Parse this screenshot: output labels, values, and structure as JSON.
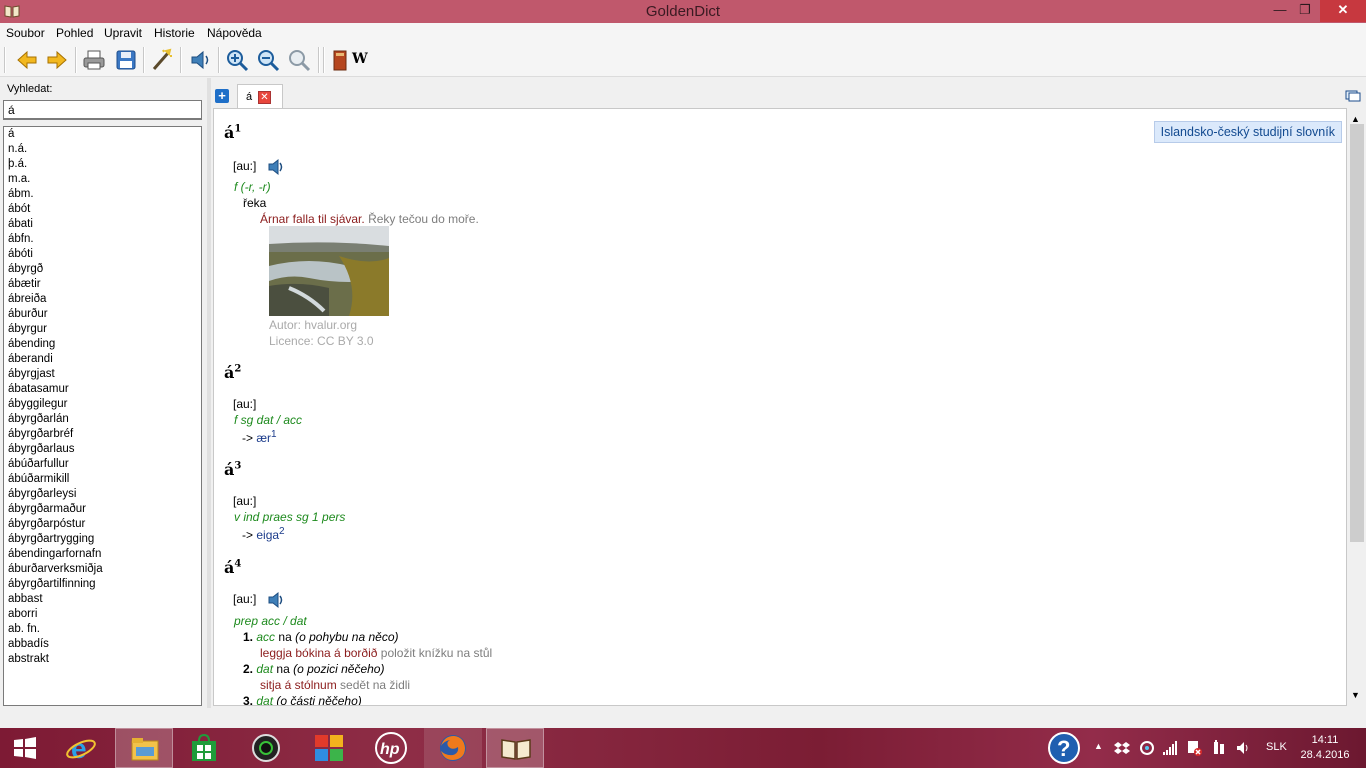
{
  "window": {
    "title": "GoldenDict"
  },
  "menu": [
    "Soubor",
    "Pohled",
    "Upravit",
    "Historie",
    "Nápověda"
  ],
  "toolbar": {
    "icons": [
      "back-icon",
      "forward-icon",
      "print-icon",
      "save-icon",
      "scan-popup-icon",
      "pronounce-icon",
      "zoom-in-icon",
      "zoom-out-icon",
      "zoom-reset-icon",
      "dictionary-book-icon",
      "wikipedia-icon"
    ],
    "wiki_label": "W"
  },
  "search": {
    "label": "Vyhledat:",
    "value": "á"
  },
  "wordlist": [
    "á",
    "n.á.",
    "þ.á.",
    "m.a.",
    "ábm.",
    "ábót",
    "ábati",
    "ábfn.",
    "ábóti",
    "ábyrgð",
    "ábætir",
    "ábreiða",
    "áburður",
    "ábyrgur",
    "ábending",
    "áberandi",
    "ábyrgjast",
    "ábatasamur",
    "ábyggilegur",
    "ábyrgðarlán",
    "ábyrgðarbréf",
    "ábyrgðarlaus",
    "ábúðarfullur",
    "ábúðarmikill",
    "ábyrgðarleysi",
    "ábyrgðarmaður",
    "ábyrgðarpóstur",
    "ábyrgðartrygging",
    "ábendingarfornafn",
    "áburðarverksmiðja",
    "ábyrgðartilfinning",
    "abbast",
    "aborri",
    "ab. fn.",
    "abbadís",
    "abstrakt"
  ],
  "tabs": [
    {
      "label": "á"
    }
  ],
  "article": {
    "dictionary": "Islandsko-český studijní slovník",
    "entries": [
      {
        "headword": "á",
        "sup": "1",
        "pron": "[au:]",
        "gram": "f (-r, -r)",
        "meaning": "řeka",
        "ex_is": "Árnar falla til sjávar.",
        "ex_cs": "Řeky tečou do moře.",
        "image_author": "Autor: hvalur.org",
        "image_license": "Licence: CC BY 3.0"
      },
      {
        "headword": "á",
        "sup": "2",
        "pron": "[au:]",
        "gram": "f sg dat / acc",
        "arrow": "->",
        "ref": "ær",
        "ref_sup": "1"
      },
      {
        "headword": "á",
        "sup": "3",
        "pron": "[au:]",
        "gram": "v ind praes sg 1 pers",
        "arrow": "->",
        "ref": "eiga",
        "ref_sup": "2"
      },
      {
        "headword": "á",
        "sup": "4",
        "pron": "[au:]",
        "gram": "prep acc / dat",
        "senses": [
          {
            "num": "1.",
            "case": "acc",
            "word": "na",
            "note": "(o pohybu na něco)",
            "ex_is": "leggja bókina á borðið",
            "ex_cs": "položit knížku na stůl"
          },
          {
            "num": "2.",
            "case": "dat",
            "word": "na",
            "note": "(o pozici něčeho)",
            "ex_is": "sitja á stólnum",
            "ex_cs": "sedět na židli"
          },
          {
            "num": "3.",
            "case": "dat",
            "word": "",
            "note": "(o části něčeho)"
          }
        ]
      }
    ]
  },
  "taskbar": {
    "apps": [
      "windows-start-icon",
      "internet-explorer-icon",
      "file-explorer-icon",
      "store-icon",
      "camera-app-icon",
      "pinwheel-app-icon",
      "hp-icon",
      "firefox-icon",
      "goldendict-icon"
    ],
    "tray": {
      "language": "SLK",
      "time": "14:11",
      "date": "28.4.2016"
    }
  },
  "colors": {
    "titlebar": "#c0586c",
    "close": "#c7383f",
    "gram": "#1d8a1d",
    "example": "#8b1c1c",
    "dict_label_bg": "#dbe9fb"
  }
}
